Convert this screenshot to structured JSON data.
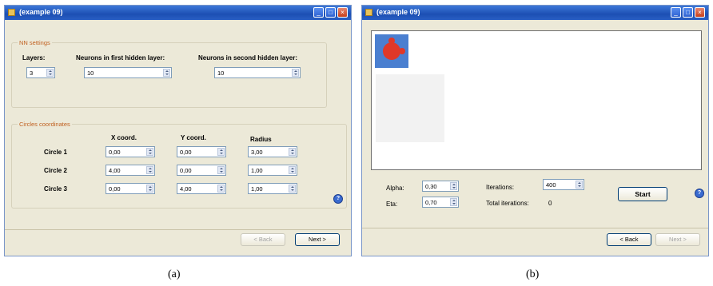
{
  "window_a": {
    "title": "(example 09)",
    "nn_settings": {
      "group_title": "NN settings",
      "layers_label": "Layers:",
      "layers_value": "3",
      "first_hidden_label": "Neurons in first hidden layer:",
      "first_hidden_value": "10",
      "second_hidden_label": "Neurons in second hidden layer:",
      "second_hidden_value": "10"
    },
    "circles": {
      "group_title": "Circles coordinates",
      "headers": {
        "x": "X coord.",
        "y": "Y coord.",
        "r": "Radius"
      },
      "rows": [
        {
          "name": "Circle 1",
          "x": "0,00",
          "y": "0,00",
          "r": "3,00"
        },
        {
          "name": "Circle 2",
          "x": "4,00",
          "y": "0,00",
          "r": "1,00"
        },
        {
          "name": "Circle 3",
          "x": "0,00",
          "y": "4,00",
          "r": "1,00"
        }
      ]
    },
    "back_label": "< Back",
    "next_label": "Next >"
  },
  "window_b": {
    "title": "(example 09)",
    "alpha_label": "Alpha:",
    "alpha_value": "0,30",
    "eta_label": "Eta:",
    "eta_value": "0,70",
    "iterations_label": "Iterations:",
    "iterations_value": "400",
    "total_iterations_label": "Total iterations:",
    "total_iterations_value": "0",
    "start_label": "Start",
    "back_label": "< Back",
    "next_label": "Next >"
  },
  "help_glyph": "?",
  "captions": {
    "a": "(a)",
    "b": "(b)"
  },
  "colors": {
    "titlebar": "#2a5fc4",
    "window_face": "#ece9d8",
    "group_title": "#c06020",
    "plot_blue": "#4a7fd0",
    "plot_red": "#e03828"
  }
}
